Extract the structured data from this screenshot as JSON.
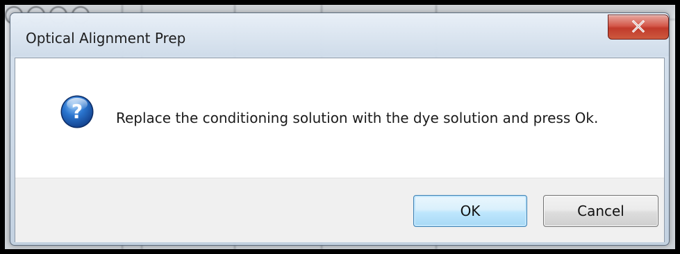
{
  "window": {
    "title": "Optical Alignment Prep",
    "close_icon": "close-icon"
  },
  "message": {
    "icon": "question-icon",
    "text": "Replace the conditioning solution with the dye solution and press Ok."
  },
  "buttons": {
    "ok_label": "OK",
    "cancel_label": "Cancel"
  },
  "colors": {
    "close_button": "#c13a2b",
    "ok_button_border": "#3c7fb1",
    "question_icon": "#1f5fb3"
  }
}
